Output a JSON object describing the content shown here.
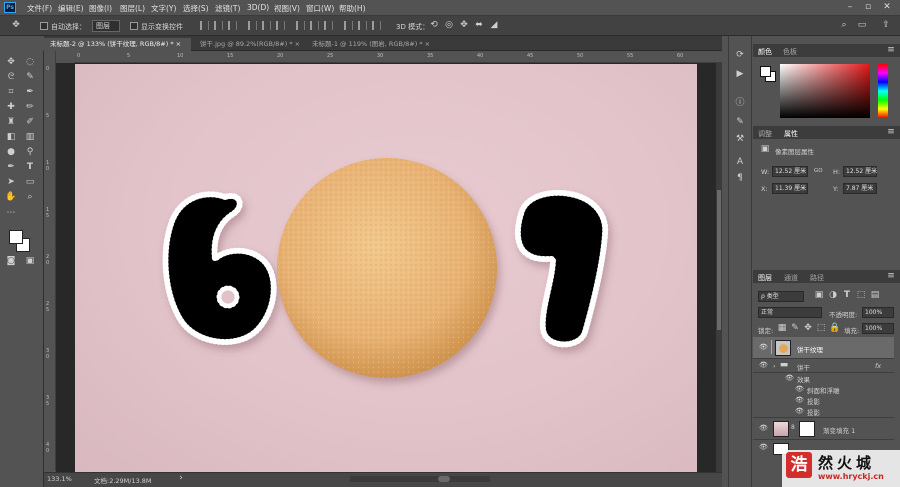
{
  "menu": {
    "app_icon": "Ps",
    "items": [
      "文件(F)",
      "编辑(E)",
      "图像(I)",
      "图层(L)",
      "文字(Y)",
      "选择(S)",
      "滤镜(T)",
      "3D(D)",
      "视图(V)",
      "窗口(W)",
      "帮助(H)"
    ]
  },
  "window_controls": {
    "minimize": "–",
    "restore": "▫",
    "close": "✕"
  },
  "options": {
    "auto_select_label": "自动选择：",
    "auto_select_value": "图层",
    "show_transform_label": "显示变换控件",
    "mode_3d_label": "3D 模式："
  },
  "tabs": [
    {
      "label": "未标题-2 @ 133% (饼干纹理, RGB/8#) *",
      "close": "×"
    },
    {
      "label": "饼干.jpg @ 89.2%(RGB/8#) *",
      "close": "×"
    },
    {
      "label": "未标题-1 @ 119% (图岩, RGB/8#) *",
      "close": "×"
    }
  ],
  "ruler": {
    "top": [
      "0",
      "5",
      "10",
      "15",
      "20",
      "25",
      "30",
      "35",
      "40",
      "45",
      "50",
      "55",
      "60"
    ],
    "left": [
      "0",
      "5",
      "1\n0",
      "1\n5",
      "2\n0",
      "2\n5",
      "3\n0",
      "3\n5",
      "4\n0"
    ]
  },
  "canvas": {
    "left_glyph": "6",
    "right_glyph": "1",
    "colors": {
      "glyph_fill": "#000000",
      "glyph_outline": "#ffffff",
      "cookie": "#e9b878",
      "background": "#e2c4ca"
    }
  },
  "status": {
    "zoom": "133.1%",
    "doc": "文档:2.29M/13.8M"
  },
  "panels": {
    "color_tabs": [
      "颜色",
      "色板"
    ],
    "prop_tabs": [
      "调整",
      "属性"
    ],
    "prop_header": "像素图层属性",
    "props": {
      "w_label": "W:",
      "w_value": "12.52 厘米",
      "link": "GO",
      "h_label": "H:",
      "h_value": "12.52 厘米",
      "x_label": "X:",
      "x_value": "11.39 厘米",
      "y_label": "Y:",
      "y_value": "7.87 厘米"
    },
    "layers_tabs": [
      "图层",
      "通道",
      "路径"
    ],
    "filter_kind": "ρ 类型",
    "blend_mode": "正常",
    "opacity_label": "不透明度:",
    "opacity_value": "100%",
    "lock_label": "锁定:",
    "fill_label": "填充:",
    "fill_value": "100%",
    "layers": [
      {
        "name": "饼干纹理"
      },
      {
        "name": "饼干",
        "fx": "fx"
      },
      {
        "name": "效果"
      },
      {
        "name": "斜面和浮雕"
      },
      {
        "name": "投影"
      },
      {
        "name": "投影"
      },
      {
        "name": "渐变填充 1"
      }
    ]
  },
  "watermark": {
    "badge": "浩",
    "title": "然火城",
    "url": "www.hryckj.cn"
  }
}
